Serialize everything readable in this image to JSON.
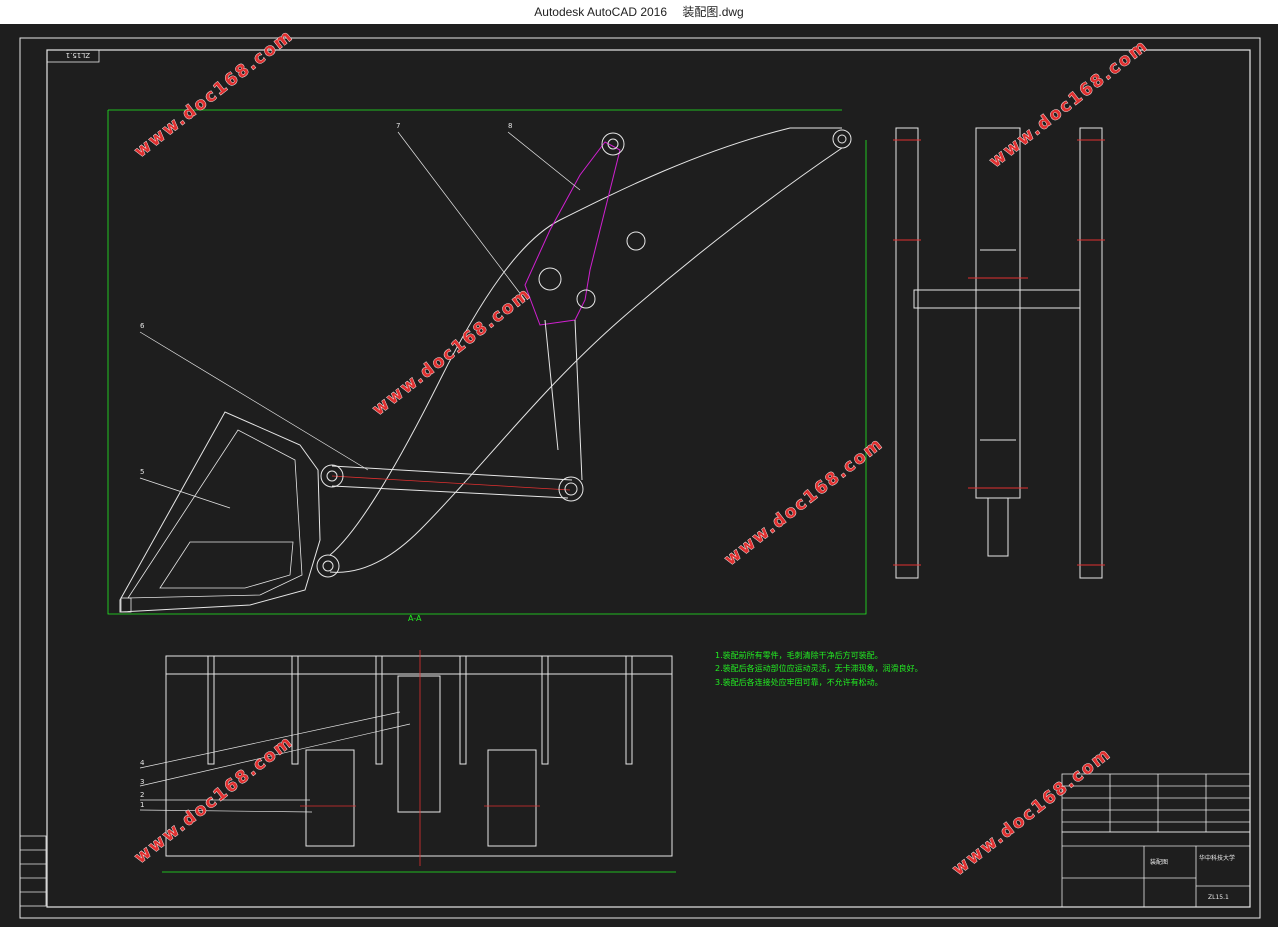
{
  "window": {
    "app_title": "Autodesk AutoCAD 2016",
    "file_name": "装配图.dwg"
  },
  "drawing": {
    "corner_code": "ZL15.1",
    "section_label": "A-A",
    "part_labels": [
      "7",
      "8",
      "6",
      "5",
      "4",
      "3",
      "2",
      "1"
    ],
    "notes": [
      "1.装配前所有零件，毛刺清除干净后方可装配。",
      "2.装配后各运动部位应运动灵活，无卡滞现象，润滑良好。",
      "3.装配后各连接处应牢固可靠，不允许有松动。"
    ],
    "watermark": "www.doc168.com",
    "title_block": {
      "drawing_number": "ZL15.1",
      "name": "装配图",
      "school": "华中科技大学"
    }
  },
  "colors": {
    "background": "#1e1e1e",
    "lines": "#e6e6e6",
    "centerline": "#e03030",
    "linkage": "#d020d0",
    "dimension": "#22ee22",
    "watermark": "#e03030"
  }
}
